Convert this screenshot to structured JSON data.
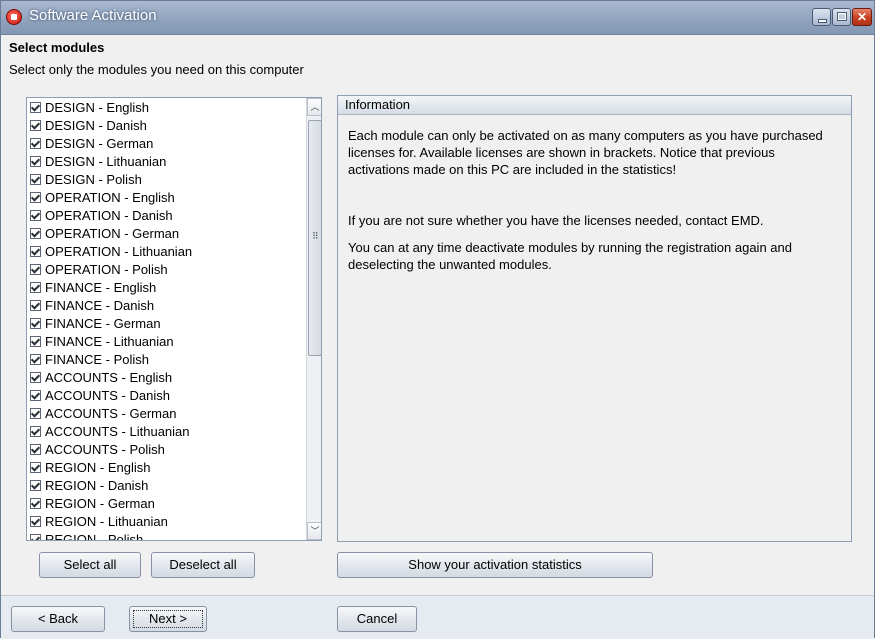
{
  "window": {
    "title": "Software Activation"
  },
  "header": {
    "heading": "Select modules",
    "subheading": "Select only the modules you need on this computer"
  },
  "modules": [
    {
      "label": "DESIGN - English",
      "checked": true
    },
    {
      "label": "DESIGN - Danish",
      "checked": true
    },
    {
      "label": "DESIGN - German",
      "checked": true
    },
    {
      "label": "DESIGN - Lithuanian",
      "checked": true
    },
    {
      "label": "DESIGN - Polish",
      "checked": true
    },
    {
      "label": "OPERATION - English",
      "checked": true
    },
    {
      "label": "OPERATION - Danish",
      "checked": true
    },
    {
      "label": "OPERATION - German",
      "checked": true
    },
    {
      "label": "OPERATION - Lithuanian",
      "checked": true
    },
    {
      "label": "OPERATION - Polish",
      "checked": true
    },
    {
      "label": "FINANCE - English",
      "checked": true
    },
    {
      "label": "FINANCE - Danish",
      "checked": true
    },
    {
      "label": "FINANCE - German",
      "checked": true
    },
    {
      "label": "FINANCE - Lithuanian",
      "checked": true
    },
    {
      "label": "FINANCE - Polish",
      "checked": true
    },
    {
      "label": "ACCOUNTS - English",
      "checked": true
    },
    {
      "label": "ACCOUNTS - Danish",
      "checked": true
    },
    {
      "label": "ACCOUNTS - German",
      "checked": true
    },
    {
      "label": "ACCOUNTS - Lithuanian",
      "checked": true
    },
    {
      "label": "ACCOUNTS - Polish",
      "checked": true
    },
    {
      "label": "REGION - English",
      "checked": true
    },
    {
      "label": "REGION - Danish",
      "checked": true
    },
    {
      "label": "REGION - German",
      "checked": true
    },
    {
      "label": "REGION - Lithuanian",
      "checked": true
    },
    {
      "label": "REGION - Polish",
      "checked": true
    }
  ],
  "info": {
    "title": "Information",
    "paragraphs": [
      "Each module can only be activated on as many computers as you have purchased licenses for.  Available licenses are shown in brackets. Notice that previous activations made on this PC are included in the statistics!",
      "If you are not sure whether you have the licenses needed, contact EMD.",
      "You can at any time deactivate modules by running the registration again and deselecting the unwanted modules."
    ]
  },
  "buttons": {
    "select_all": "Select all",
    "deselect_all": "Deselect all",
    "show_stats": "Show your activation statistics",
    "back": "< Back",
    "next": "Next >",
    "cancel": "Cancel"
  },
  "icons": {
    "app": "app-logo-icon",
    "minimize": "minimize-icon",
    "maximize": "maximize-icon",
    "close": "close-icon",
    "scroll_up": "chevron-up-icon",
    "scroll_down": "chevron-down-icon"
  },
  "colors": {
    "titlebar": "#8fa2bd",
    "close_button": "#c6401f",
    "window_bg": "#f0f0f0"
  }
}
